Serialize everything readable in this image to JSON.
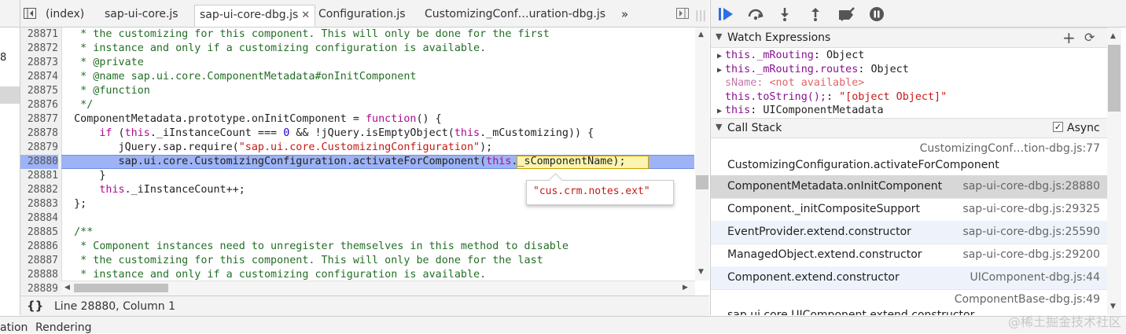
{
  "left_strip": {
    "partial_number": "8"
  },
  "tabs": [
    {
      "label": "(index)"
    },
    {
      "label": "sap-ui-core.js"
    },
    {
      "label": "sap-ui-core-dbg.js",
      "close": "✕"
    },
    {
      "label": "Configuration.js"
    },
    {
      "label": "CustomizingConf…uration-dbg.js"
    }
  ],
  "tabs_overflow": "»",
  "editor": {
    "line_numbers": [
      "28871",
      "28872",
      "28873",
      "28874",
      "28875",
      "28876",
      "28877",
      "28878",
      "28879",
      "28880",
      "28881",
      "28882",
      "28883",
      "28884",
      "28885",
      "28886",
      "28887",
      "28888",
      "28889"
    ],
    "lines": {
      "l1": "   * the customizing for this component. This will only be done for the first",
      "l2": "   * instance and only if a customizing configuration is available.",
      "l3": "   * @private",
      "l4": "   * @name sap.ui.core.ComponentMetadata#onInitComponent",
      "l5": "   * @function",
      "l6": "   */",
      "l7a": "  ComponentMetadata.prototype.onInitComponent = ",
      "l7b": "function",
      "l7c": "() {",
      "l8a": "      ",
      "l8b": "if",
      "l8c": " (",
      "l8d": "this",
      "l8e": "._iInstanceCount === ",
      "l8f": "0",
      "l8g": " && !jQuery.isEmptyObject(",
      "l8h": "this",
      "l8i": "._mCustomizing)) {",
      "l9a": "         jQuery.sap.require(",
      "l9b": "\"sap.ui.core.CustomizingConfiguration\"",
      "l9c": ");",
      "l10a": "         sap.ui.core.CustomizingConfiguration.activateForComponent(",
      "l10b": "this",
      "l10c": "._sComponentName",
      "l10d": ");",
      "l11": "      }",
      "l12a": "      ",
      "l12b": "this",
      "l12c": "._iInstanceCount++;",
      "l13": "  };",
      "l14": "",
      "l15": "  /**",
      "l16": "   * Component instances need to unregister themselves in this method to disable",
      "l17": "   * the customizing for this component. This will only be done for the last",
      "l18": "   * instance and only if a customizing configuration is available."
    }
  },
  "popover": {
    "value": "\"cus.crm.notes.ext\""
  },
  "status": {
    "braces": "{}",
    "position": "Line 28880, Column 1"
  },
  "drawer": {
    "tab1": "ation",
    "tab2": "Rendering"
  },
  "watermark": "@稀土掘金技术社区",
  "debugger_toolbar": {
    "icons": [
      "resume-icon",
      "step-over-icon",
      "step-into-icon",
      "step-out-icon",
      "deactivate-breakpoints-icon",
      "pause-on-exceptions-icon"
    ]
  },
  "watch": {
    "title": "Watch Expressions",
    "add": "+",
    "refresh": "⟳",
    "items": [
      {
        "expand": "▶",
        "key": "this._mRouting",
        "sep": ": ",
        "value": "Object"
      },
      {
        "expand": "▶",
        "key": "this._mRouting.routes",
        "sep": ": ",
        "value": "Object"
      },
      {
        "expand": "",
        "key": "sName",
        "sep": ": ",
        "value": "<not available>"
      },
      {
        "expand": "",
        "key": "this.toString();",
        "sep": ": ",
        "value": "\"[object Object]\""
      },
      {
        "expand": "▶",
        "key": "this",
        "sep": ": ",
        "value": "UIComponentMetadata"
      }
    ]
  },
  "callstack": {
    "title": "Call Stack",
    "async_label": "Async",
    "async_checked": true,
    "frames": [
      {
        "fn": "CustomizingConfiguration.activateForComponent",
        "loc": "CustomizingConf…tion-dbg.js:77"
      },
      {
        "fn": "ComponentMetadata.onInitComponent",
        "loc": "sap-ui-core-dbg.js:28880"
      },
      {
        "fn": "Component._initCompositeSupport",
        "loc": "sap-ui-core-dbg.js:29325"
      },
      {
        "fn": "EventProvider.extend.constructor",
        "loc": "sap-ui-core-dbg.js:25590"
      },
      {
        "fn": "ManagedObject.extend.constructor",
        "loc": "sap-ui-core-dbg.js:29200"
      },
      {
        "fn": "Component.extend.constructor",
        "loc": "UIComponent-dbg.js:44"
      },
      {
        "fn": "sap.ui.core.UIComponent.extend.constructor",
        "loc": "ComponentBase-dbg.js:49"
      }
    ]
  },
  "colors": {
    "selection": "#9db3f5",
    "highlight_expr": "#fcf4b0",
    "selected_frame": "#d7d7d7",
    "alt_frame": "#eef3fb"
  }
}
